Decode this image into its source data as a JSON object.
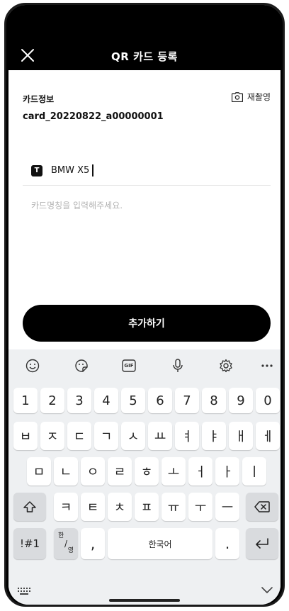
{
  "header": {
    "title": "QR 카드 등록"
  },
  "card": {
    "label": "카드정보",
    "id": "card_20220822_a00000001",
    "retake_label": "재촬영"
  },
  "name_field": {
    "value": "BMW X5",
    "hint": "카드명칭을 입력해주세요."
  },
  "action": {
    "add_label": "추가하기"
  },
  "keyboard": {
    "number_row": [
      "1",
      "2",
      "3",
      "4",
      "5",
      "6",
      "7",
      "8",
      "9",
      "0"
    ],
    "row1": [
      "ㅂ",
      "ㅈ",
      "ㄷ",
      "ㄱ",
      "ㅅ",
      "ㅛ",
      "ㅕ",
      "ㅑ",
      "ㅐ",
      "ㅔ"
    ],
    "row2": [
      "ㅁ",
      "ㄴ",
      "ㅇ",
      "ㄹ",
      "ㅎ",
      "ㅗ",
      "ㅓ",
      "ㅏ",
      "ㅣ"
    ],
    "row3": [
      "ㅋ",
      "ㅌ",
      "ㅊ",
      "ㅍ",
      "ㅠ",
      "ㅜ",
      "ㅡ"
    ],
    "symbols_label": "!#1",
    "lang_top": "한",
    "lang_bottom": "영",
    "comma_label": ",",
    "space_label": "한국어",
    "period_label": ".",
    "gif_label": "GIF"
  },
  "icons": [
    "close-icon",
    "camera-icon",
    "text-icon",
    "emoji-icon",
    "sticker-icon",
    "gif-icon",
    "mic-icon",
    "gear-icon",
    "more-icon",
    "shift-icon",
    "backspace-icon",
    "enter-icon",
    "keyboard-grid-icon",
    "chevron-down-icon"
  ]
}
